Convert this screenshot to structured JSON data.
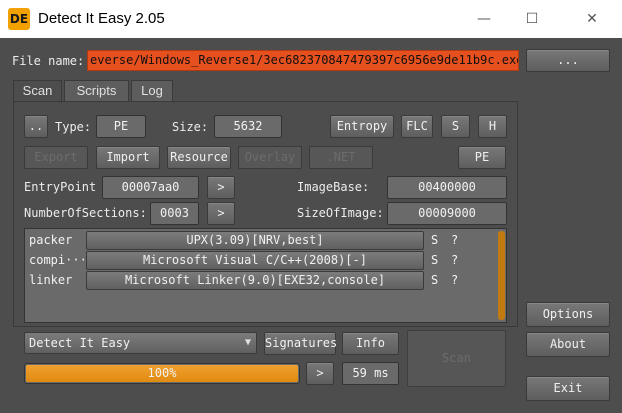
{
  "titlebar": {
    "icon_text": "DE",
    "title": "Detect It Easy 2.05",
    "minimize": "—",
    "maximize": "☐",
    "close": "✕"
  },
  "file": {
    "label": "File name:",
    "value": "everse/Windows_Reverse1/3ec682370847479397c6956e9de11b9c.exe",
    "browse_label": "..."
  },
  "tabs": [
    "Scan",
    "Scripts",
    "Log"
  ],
  "info": {
    "more_label": "..",
    "type_label": "Type:",
    "type_value": "PE",
    "size_label": "Size:",
    "size_value": "5632",
    "entropy_label": "Entropy",
    "flc_label": "FLC",
    "s_label": "S",
    "h_label": "H"
  },
  "actions": {
    "export": "Export",
    "import": "Import",
    "resource": "Resource",
    "overlay": "Overlay",
    "net": ".NET",
    "pe": "PE"
  },
  "pe_fields": {
    "entry_point_label": "EntryPoint",
    "entry_point_value": "00007aa0",
    "image_base_label": "ImageBase:",
    "image_base_value": "00400000",
    "sections_label": "NumberOfSections:",
    "sections_value": "0003",
    "size_of_image_label": "SizeOfImage:",
    "size_of_image_value": "00009000",
    "arrow": ">"
  },
  "results": [
    {
      "type": "packer",
      "name": "UPX(3.09)[NRV,best]",
      "s": "S",
      "q": "?"
    },
    {
      "type": "compi···",
      "name": "Microsoft Visual C/C++(2008)[-]",
      "s": "S",
      "q": "?"
    },
    {
      "type": "linker",
      "name": "Microsoft Linker(9.0)[EXE32,console]",
      "s": "S",
      "q": "?"
    }
  ],
  "bottom": {
    "database": "Detect It Easy",
    "signatures": "Signatures",
    "info": "Info",
    "progress_text": "100%",
    "progress_value": 1.0,
    "arrow": ">",
    "time": "59 ms",
    "scan": "Scan"
  },
  "side": {
    "options": "Options",
    "about": "About",
    "exit": "Exit"
  },
  "colors": {
    "background": "#4d4d4d",
    "filename_field": "#e6501e",
    "progress": "#e08a10",
    "icon": "#f2a100"
  }
}
